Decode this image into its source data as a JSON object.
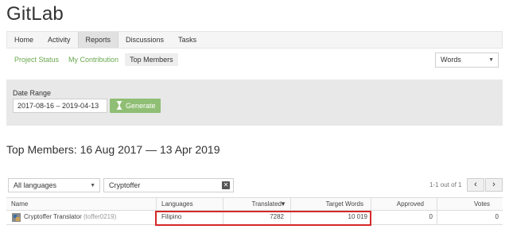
{
  "app": {
    "title": "GitLab"
  },
  "main_nav": [
    "Home",
    "Activity",
    "Reports",
    "Discussions",
    "Tasks"
  ],
  "sub_nav": [
    "Project Status",
    "My Contribution",
    "Top Members"
  ],
  "metric_select": {
    "value": "Words"
  },
  "filter": {
    "label": "Date Range",
    "date_value": "2017-08-16 – 2019-04-13",
    "generate_label": "Generate"
  },
  "heading": "Top Members: 16 Aug 2017 — 13 Apr 2019",
  "controls": {
    "language_select": "All languages",
    "search_value": "Cryptoffer",
    "pagination_text": "1-1 out of 1"
  },
  "table": {
    "headers": {
      "name": "Name",
      "languages": "Languages",
      "translated": "Translated",
      "target_words": "Target Words",
      "approved": "Approved",
      "votes": "Votes"
    },
    "rows": [
      {
        "name": "Cryptoffer Translator",
        "username": "(toffer0219)",
        "language": "Filipino",
        "translated": "7282",
        "target_words": "10 019",
        "approved": "0",
        "votes": "0"
      }
    ]
  },
  "colors": {
    "accent_green": "#6aa84f",
    "button_green": "#8fbe74",
    "highlight_red": "#d62828"
  }
}
